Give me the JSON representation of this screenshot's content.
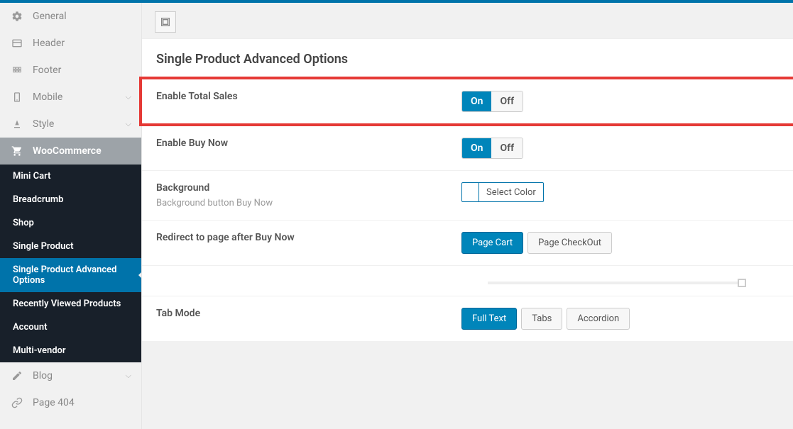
{
  "sidebar": {
    "items": [
      {
        "label": "General",
        "icon": "gear"
      },
      {
        "label": "Header",
        "icon": "header"
      },
      {
        "label": "Footer",
        "icon": "footer"
      },
      {
        "label": "Mobile",
        "icon": "mobile",
        "expandable": true
      },
      {
        "label": "Style",
        "icon": "style",
        "expandable": true
      },
      {
        "label": "WooCommerce",
        "icon": "cart",
        "section": "woo"
      },
      {
        "label": "Blog",
        "icon": "blog",
        "expandable": true
      },
      {
        "label": "Page 404",
        "icon": "link"
      }
    ],
    "sub": [
      {
        "label": "Mini Cart"
      },
      {
        "label": "Breadcrumb"
      },
      {
        "label": "Shop"
      },
      {
        "label": "Single Product"
      },
      {
        "label": "Single Product Advanced Options",
        "active": true
      },
      {
        "label": "Recently Viewed Products"
      },
      {
        "label": "Account"
      },
      {
        "label": "Multi-vendor"
      }
    ]
  },
  "main": {
    "title": "Single Product Advanced Options",
    "fields": {
      "total_sales": {
        "label": "Enable Total Sales",
        "on": "On",
        "off": "Off"
      },
      "buy_now": {
        "label": "Enable Buy Now",
        "on": "On",
        "off": "Off"
      },
      "background": {
        "label": "Background",
        "desc": "Background button Buy Now",
        "select_color": "Select Color"
      },
      "redirect": {
        "label": "Redirect to page after Buy Now",
        "opt1": "Page Cart",
        "opt2": "Page CheckOut"
      },
      "tab_mode": {
        "label": "Tab Mode",
        "opt1": "Full Text",
        "opt2": "Tabs",
        "opt3": "Accordion"
      }
    }
  }
}
